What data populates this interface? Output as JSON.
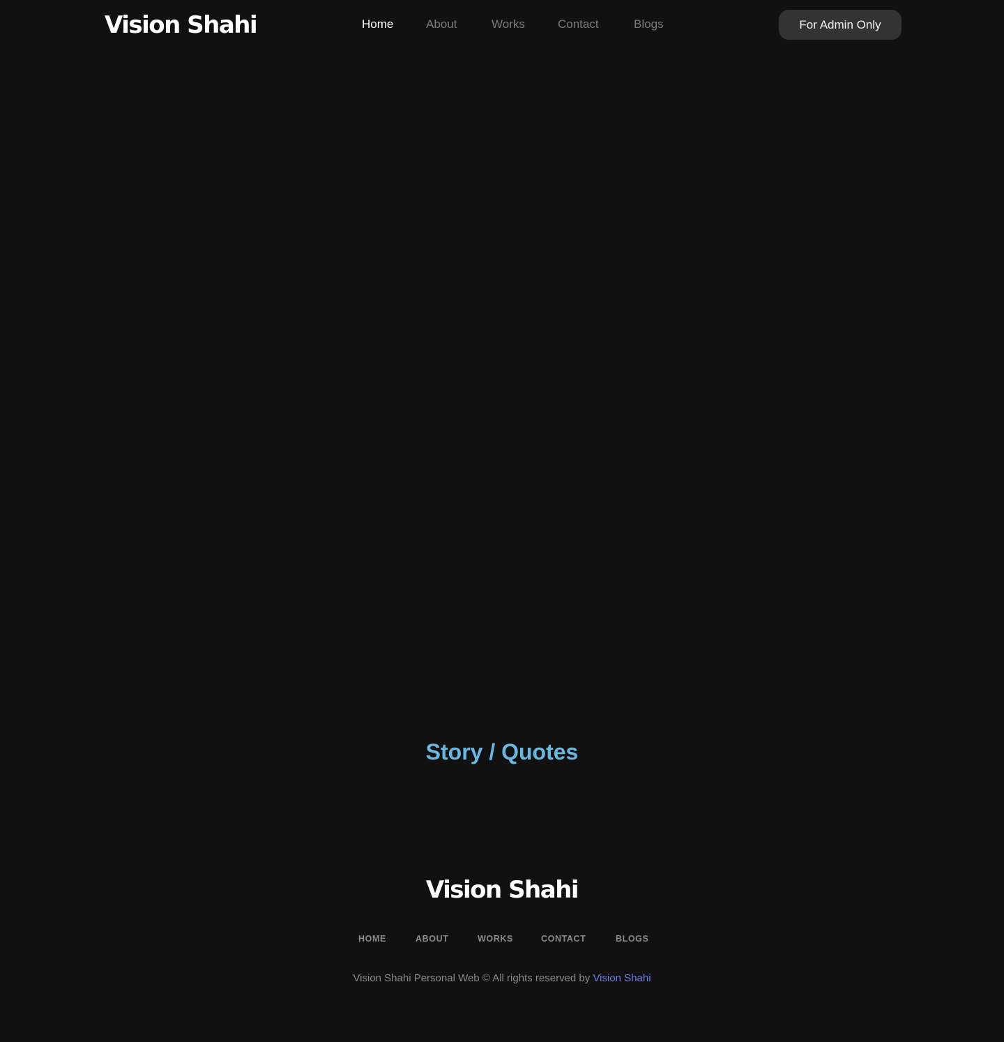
{
  "header": {
    "logo": "Vision Shahi",
    "nav": {
      "home": "Home",
      "about": "About",
      "works": "Works",
      "contact": "Contact",
      "blogs": "Blogs"
    },
    "active_nav": "Home",
    "admin_button": "For Admin Only"
  },
  "main": {
    "section_title": "Story / Quotes"
  },
  "footer": {
    "logo": "Vision Shahi",
    "nav": {
      "home": "HOME",
      "about": "ABOUT",
      "works": "WORKS",
      "contact": "CONTACT",
      "blogs": "BLOGS"
    },
    "copyright_text": "Vision Shahi Personal Web © All rights reserved by",
    "copyright_link": "Vision Shahi"
  },
  "colors": {
    "background": "#111111",
    "accent_title": "#6ab7e0",
    "link": "#6f7de6",
    "button_bg": "#333333",
    "nav_inactive": "#7b7b7b"
  }
}
